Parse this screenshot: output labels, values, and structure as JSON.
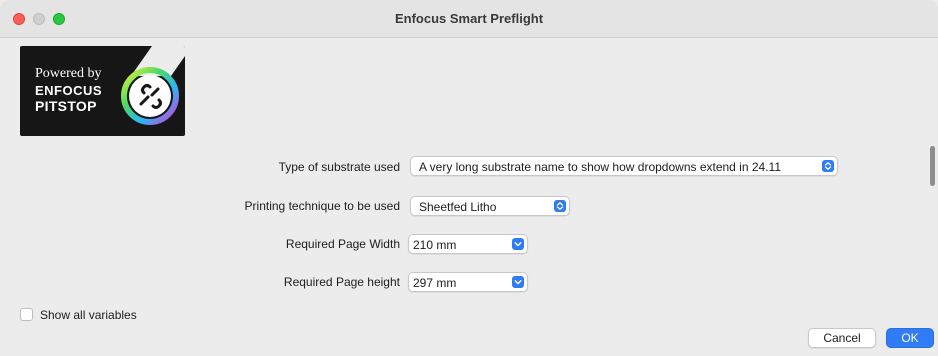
{
  "window": {
    "title": "Enfocus Smart Preflight"
  },
  "logo": {
    "powered_by": "Powered by",
    "brand_line1": "ENFOCUS",
    "brand_line2": "PITSTOP",
    "emblem_icon": "pitstop-wrench-icon"
  },
  "form": {
    "fields": [
      {
        "label": "Type of substrate used",
        "value": "A very long substrate name to show how dropdowns extend in 24.11"
      },
      {
        "label": "Printing technique to be used",
        "value": "Sheetfed Litho"
      },
      {
        "label": "Required Page Width",
        "value": "210 mm"
      },
      {
        "label": "Required Page height",
        "value": "297 mm"
      }
    ]
  },
  "footer": {
    "show_all_variables": "Show all variables",
    "show_all_variables_checked": false,
    "cancel_label": "Cancel",
    "ok_label": "OK"
  },
  "colors": {
    "accent": "#2f7cf6",
    "close": "#fe5f57",
    "maximize": "#28c840",
    "logo_background": "#161616"
  }
}
